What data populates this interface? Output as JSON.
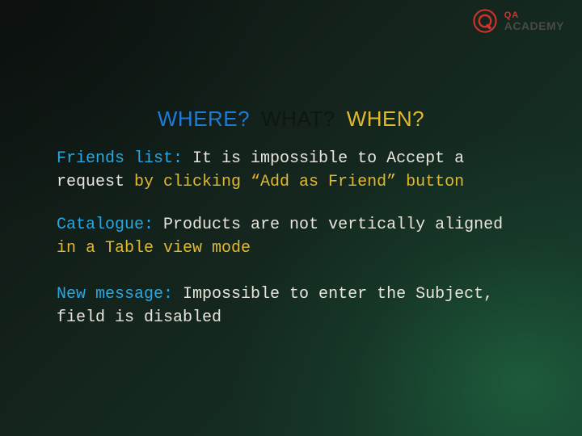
{
  "logo": {
    "qa": "QA",
    "academy": "ACADEMY"
  },
  "heading": {
    "where": "WHERE?",
    "what": "WHAT?",
    "when": "WHEN?"
  },
  "paragraphs": {
    "p1": {
      "loc": "Friends list:",
      "mid": " It is impossible to Accept a request",
      "act": " by clicking  “Add as Friend” button"
    },
    "p2": {
      "loc": "Catalogue:",
      "mid": " Products are not vertically aligned",
      "act": " in a Table view mode"
    },
    "p3": {
      "loc": "New message:",
      "mid": " Impossible to enter the Subject, field is disabled",
      "act": ""
    }
  }
}
